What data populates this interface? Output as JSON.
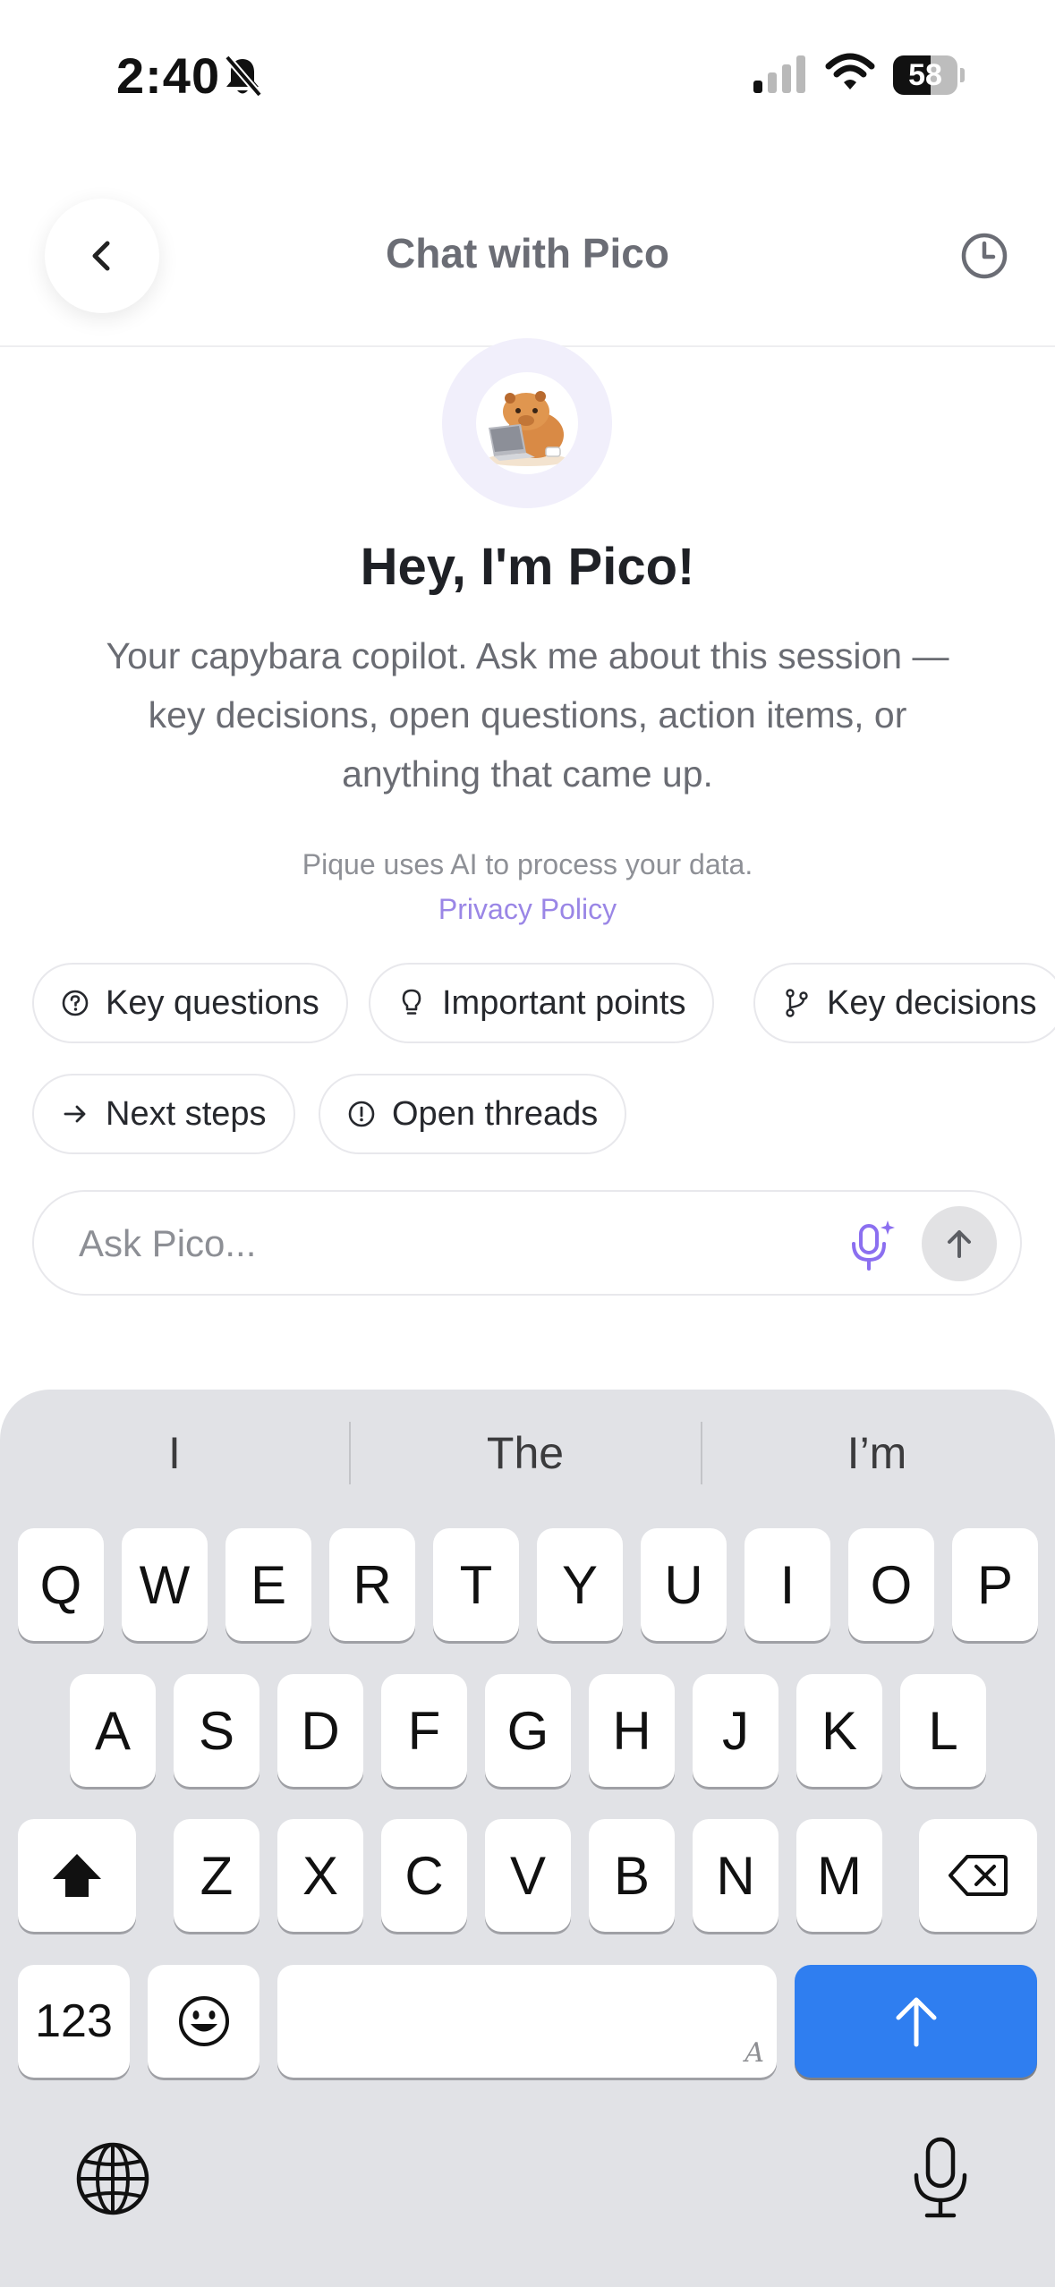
{
  "status_bar": {
    "time": "2:40",
    "battery": "58",
    "battery_level": 0.58
  },
  "header": {
    "title": "Chat with Pico"
  },
  "intro": {
    "heading": "Hey, I'm Pico!",
    "description": "Your capybara copilot. Ask me about this session — key decisions, open questions, action items, or anything that came up.",
    "disclaimer": "Pique uses AI to process your data.",
    "privacy_link": "Privacy Policy"
  },
  "chips": [
    {
      "label": "Key questions",
      "icon": "question-circle-icon"
    },
    {
      "label": "Important points",
      "icon": "lightbulb-icon"
    },
    {
      "label": "Key decisions",
      "icon": "branch-icon"
    },
    {
      "label": "Next steps",
      "icon": "arrow-right-icon"
    },
    {
      "label": "Open threads",
      "icon": "alert-circle-icon"
    }
  ],
  "input": {
    "placeholder": "Ask Pico..."
  },
  "keyboard": {
    "suggestions": [
      "I",
      "The",
      "I’m"
    ],
    "row1": [
      "Q",
      "W",
      "E",
      "R",
      "T",
      "Y",
      "U",
      "I",
      "O",
      "P"
    ],
    "row2": [
      "A",
      "S",
      "D",
      "F",
      "G",
      "H",
      "J",
      "K",
      "L"
    ],
    "row3": [
      "Z",
      "X",
      "C",
      "V",
      "B",
      "N",
      "M"
    ],
    "numbers_key": "123",
    "space_hint": "A"
  },
  "colors": {
    "accent": "#9a86e6",
    "return_key": "#2f7ef0",
    "keyboard_bg": "#e1e2e6"
  }
}
